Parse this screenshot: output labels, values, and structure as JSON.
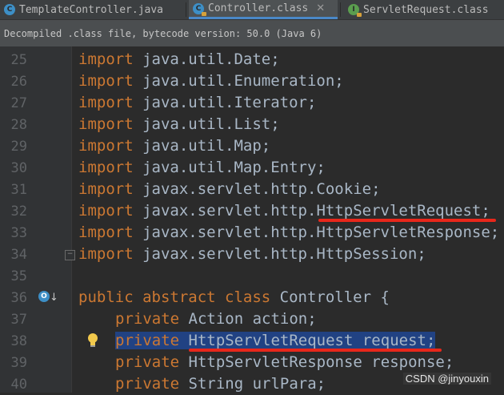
{
  "tabs": [
    {
      "label": "TemplateController.java",
      "icon": "class-icon",
      "letter": "C",
      "active": false,
      "closable": false
    },
    {
      "label": "Controller.class",
      "icon": "class-icon",
      "letter": "C",
      "active": true,
      "closable": true
    },
    {
      "label": "ServletRequest.class",
      "icon": "interface-icon",
      "letter": "I",
      "active": false,
      "closable": false
    }
  ],
  "tab_close_glyph": "✕",
  "banner": {
    "text": "Decompiled .class file, bytecode version: 50.0 (Java 6)"
  },
  "lines": [
    {
      "num": "25",
      "kw": "import",
      "rest": "java.util.Date;"
    },
    {
      "num": "26",
      "kw": "import",
      "rest": "java.util.Enumeration;"
    },
    {
      "num": "27",
      "kw": "import",
      "rest": "java.util.Iterator;"
    },
    {
      "num": "28",
      "kw": "import",
      "rest": "java.util.List;"
    },
    {
      "num": "29",
      "kw": "import",
      "rest": "java.util.Map;"
    },
    {
      "num": "30",
      "kw": "import",
      "rest": "java.util.Map.Entry;"
    },
    {
      "num": "31",
      "kw": "import",
      "rest": "javax.servlet.http.Cookie;"
    },
    {
      "num": "32",
      "kw": "import",
      "rest_a": "javax.servlet.http.",
      "rest_b": "HttpServletRequest;"
    },
    {
      "num": "33",
      "kw": "import",
      "rest": "javax.servlet.http.HttpServletResponse;"
    },
    {
      "num": "34",
      "kw": "import",
      "rest": "javax.servlet.http.HttpSession;"
    },
    {
      "num": "35"
    },
    {
      "num": "36",
      "kw": "public abstract class",
      "rest": "Controller {"
    },
    {
      "num": "37",
      "kw": "private",
      "rest": "Action action;"
    },
    {
      "num": "38",
      "kw": "private",
      "rest": "HttpServletRequest request;"
    },
    {
      "num": "39",
      "kw": "private",
      "rest": "HttpServletResponse response;"
    },
    {
      "num": "40",
      "kw": "private",
      "rest": "String urlPara;"
    }
  ],
  "gutter_icons": {
    "override_letter": "O",
    "override_arrow": "↓",
    "fold_glyph": "−"
  },
  "watermark": "CSDN @jinyouxin",
  "colors": {
    "keyword": "#cc7832",
    "text": "#a9b7c6",
    "line_number": "#606366",
    "selection": "#214283",
    "annotation_underline": "#e8271b",
    "editor_bg": "#2b2b2b",
    "gutter_bg": "#313335"
  }
}
